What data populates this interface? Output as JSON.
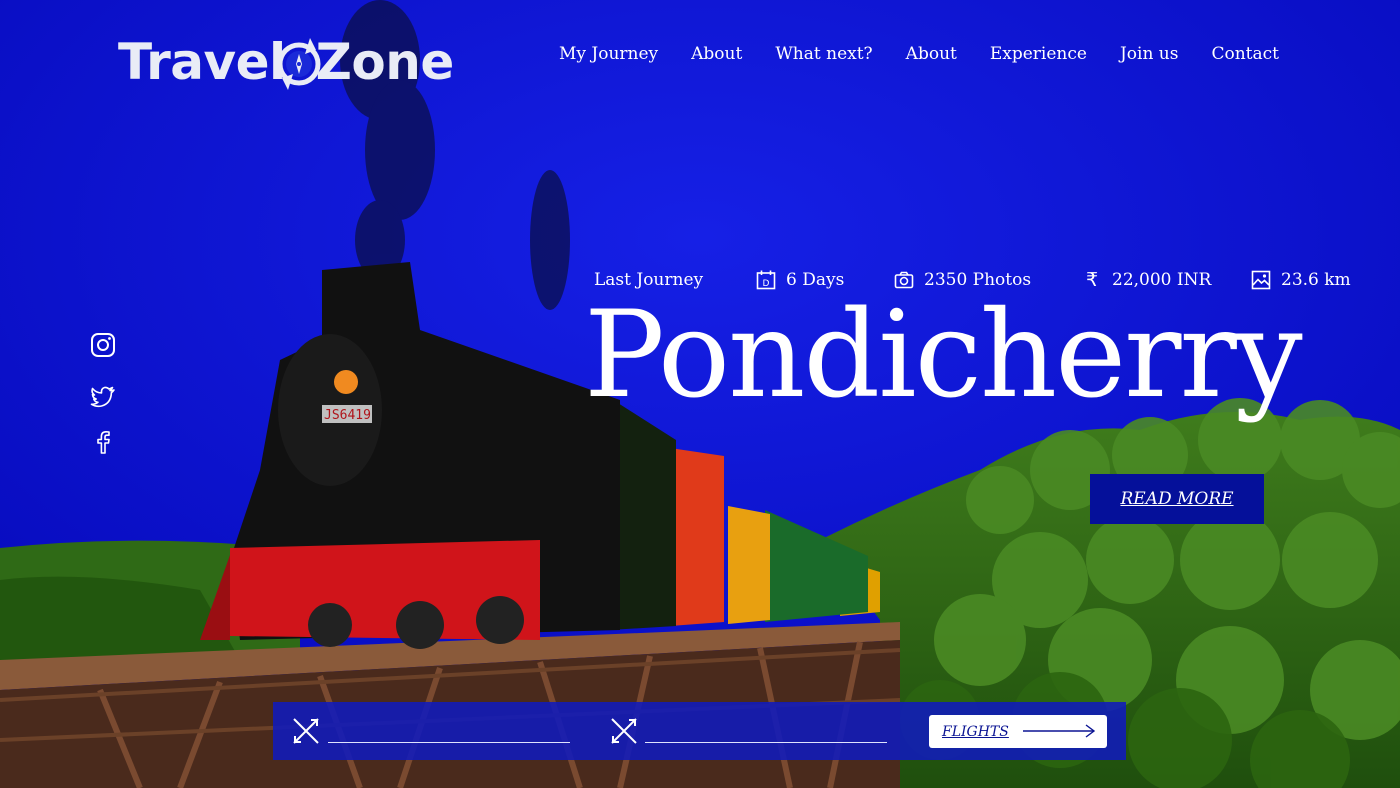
{
  "brand": {
    "left": "Travel",
    "right": "Zone",
    "logo_icon": "compass-icon"
  },
  "nav": {
    "items": [
      "My Journey",
      "About",
      "What next?",
      "About",
      "Experience",
      "Join us",
      "Contact"
    ]
  },
  "social": {
    "icons": [
      "instagram-icon",
      "twitter-icon",
      "facebook-icon"
    ]
  },
  "journey": {
    "label": "Last Journey",
    "duration": "6 Days",
    "duration_icon": "calendar-icon",
    "duration_icon_letter": "D",
    "photos": "2350 Photos",
    "photos_icon": "camera-icon",
    "cost": "22,000 INR",
    "cost_icon": "rupee-icon",
    "cost_symbol": "₹",
    "distance": "23.6 km",
    "distance_icon": "image-icon",
    "destination": "Pondicherry",
    "read_more": "READ MORE"
  },
  "photo": {
    "engine_plate": "JS6419"
  },
  "search": {
    "from_icon": "airplane-icon",
    "to_icon": "airplane-icon",
    "button_label": "FLIGHTS",
    "button_icon": "arrow-right-icon"
  },
  "colors": {
    "sky": "#0a12d8",
    "accent_button": "#05109a",
    "bar": "#101abc",
    "text": "#ffffff"
  }
}
